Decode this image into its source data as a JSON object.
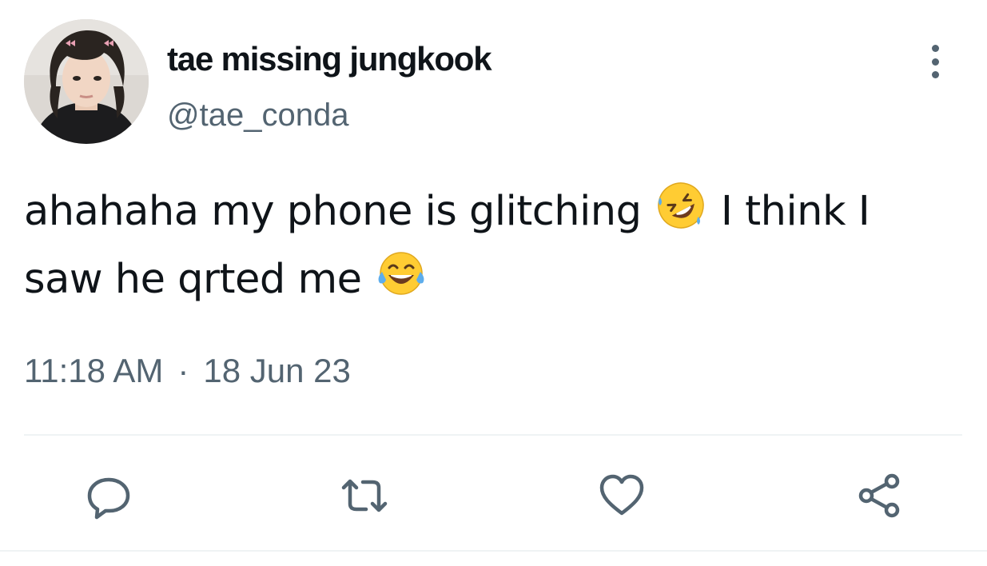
{
  "user": {
    "display_name": "tae missing jungkook",
    "handle": "@tae_conda"
  },
  "tweet": {
    "line1_text_a": "ahahaha my phone is glitching",
    "line1_text_b": "I think I",
    "line2_text": "saw he qrted me",
    "time": "11:18 AM",
    "separator": "·",
    "date": "18 Jun 23"
  },
  "icons": {
    "more": "more-vertical-icon",
    "reply": "reply-icon",
    "retweet": "retweet-icon",
    "like": "heart-icon",
    "share": "share-icon",
    "emoji_1": "rolling-on-floor-laughing-emoji",
    "emoji_2": "face-with-tears-of-joy-emoji"
  },
  "colors": {
    "text_primary": "#0f1419",
    "text_secondary": "#536471",
    "divider": "#eff3f4",
    "emoji_yellow": "#ffcc33",
    "emoji_tear": "#5dadec"
  }
}
